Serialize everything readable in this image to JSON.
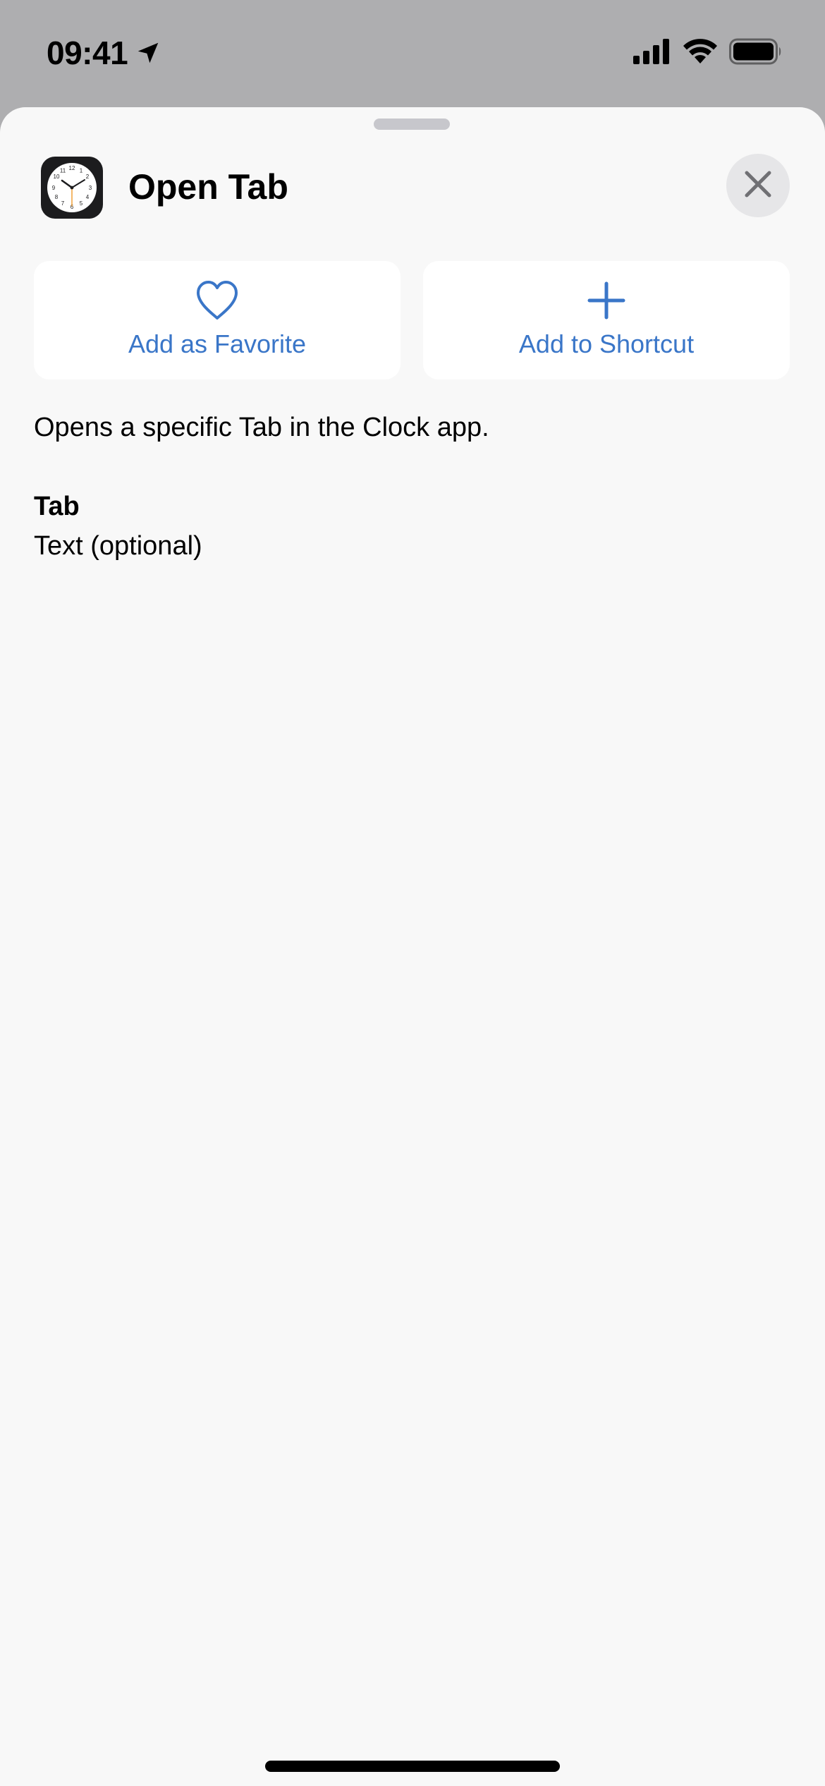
{
  "status_bar": {
    "time": "09:41",
    "location_icon": "location-arrow-icon",
    "signal_icon": "cellular-signal-icon",
    "wifi_icon": "wifi-icon",
    "battery_icon": "battery-icon"
  },
  "sheet": {
    "title": "Open Tab",
    "app_icon": "clock-app-icon",
    "close_icon": "close-icon"
  },
  "actions": {
    "favorite_label": "Add as Favorite",
    "favorite_icon": "heart-icon",
    "shortcut_label": "Add to Shortcut",
    "shortcut_icon": "plus-icon"
  },
  "content": {
    "description": "Opens a specific Tab in the Clock app.",
    "parameter_name": "Tab",
    "parameter_type": "Text (optional)"
  },
  "colors": {
    "accent": "#3a76c8",
    "sheet_background": "#f8f8f8",
    "backdrop": "#aeaeb0"
  }
}
